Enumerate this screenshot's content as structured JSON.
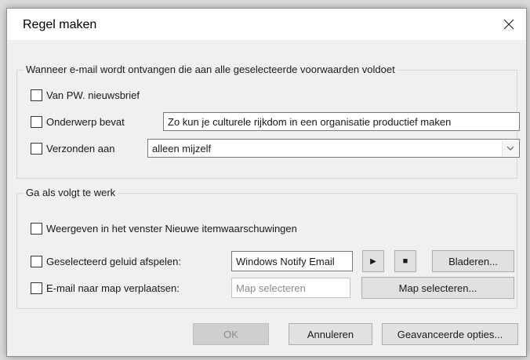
{
  "dialog": {
    "title": "Regel maken",
    "close_glyph": "✕"
  },
  "conditions": {
    "group_title": "Wanneer e-mail wordt ontvangen die aan alle geselecteerde voorwaarden voldoet",
    "from_label": "Van PW. nieuwsbrief",
    "subject_label": "Onderwerp bevat",
    "subject_value": "Zo kun je culturele rijkdom in een organisatie productief maken",
    "sent_to_label": "Verzonden aan",
    "sent_to_value": "alleen mijzelf"
  },
  "actions": {
    "group_title": "Ga als volgt te werk",
    "display_label": "Weergeven in het venster Nieuwe itemwaarschuwingen",
    "sound_label": "Geselecteerd geluid afspelen:",
    "sound_value": "Windows Notify Email",
    "play_glyph": "▶",
    "stop_glyph": "■",
    "browse_label": "Bladeren...",
    "move_label": "E-mail naar map verplaatsen:",
    "folder_placeholder": "Map selecteren",
    "select_folder_label": "Map selecteren..."
  },
  "buttons": {
    "ok": "OK",
    "cancel": "Annuleren",
    "advanced": "Geavanceerde opties..."
  }
}
